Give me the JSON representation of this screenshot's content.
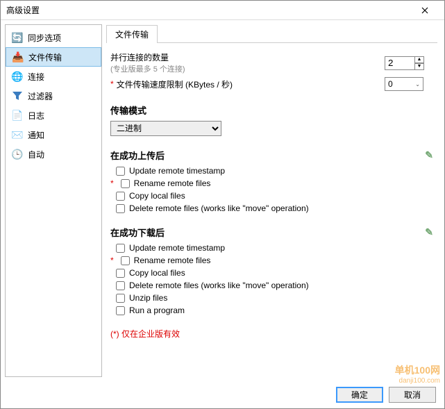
{
  "window": {
    "title": "高级设置"
  },
  "sidebar": {
    "items": [
      {
        "label": "同步选项"
      },
      {
        "label": "文件传输"
      },
      {
        "label": "连接"
      },
      {
        "label": "过滤器"
      },
      {
        "label": "日志"
      },
      {
        "label": "通知"
      },
      {
        "label": "自动"
      }
    ]
  },
  "tabs": {
    "main": "文件传输"
  },
  "fields": {
    "parallel_label": "并行连接的数量",
    "parallel_hint": "(专业版最多 5 个连接)",
    "parallel_value": "2",
    "speed_label": "文件传输速度限制 (KBytes / 秒)",
    "speed_value": "0"
  },
  "transfer_mode": {
    "title": "传输模式",
    "value": "二进制"
  },
  "upload_section": {
    "title": "在成功上传后",
    "options": [
      "Update remote timestamp",
      "Rename remote files",
      "Copy local files",
      "Delete remote files (works like \"move\" operation)"
    ]
  },
  "download_section": {
    "title": "在成功下载后",
    "options": [
      "Update remote timestamp",
      "Rename remote files",
      "Copy local files",
      "Delete remote files (works like \"move\" operation)",
      "Unzip files",
      "Run a program"
    ]
  },
  "enterprise_note": "(*) 仅在企业版有效",
  "buttons": {
    "ok": "确定",
    "cancel": "取消"
  },
  "watermark": {
    "brand": "单机100网",
    "sub": "danji100.com"
  }
}
